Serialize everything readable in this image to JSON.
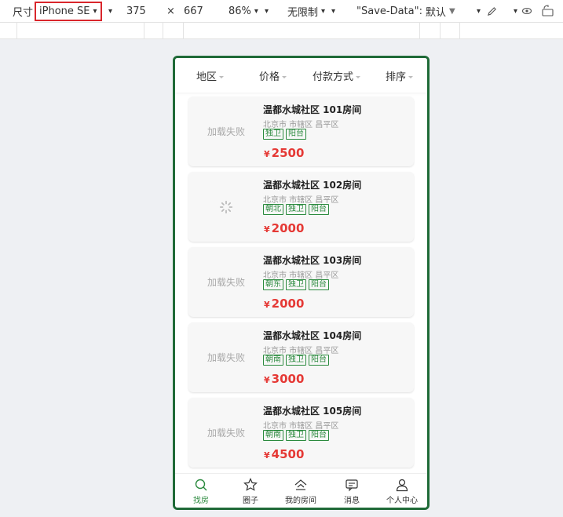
{
  "devtools": {
    "dims_label": "尺寸",
    "device": "iPhone SE",
    "width": "375",
    "times": "×",
    "height": "667",
    "zoom": "86%",
    "throttle": "无限制",
    "savedata_label": "\"Save-Data\":",
    "savedata_value": "默认"
  },
  "filters": [
    "地区",
    "价格",
    "付款方式",
    "排序"
  ],
  "cards": [
    {
      "title": "温都水城社区 101房间",
      "addr": "北京市 市辖区 昌平区",
      "tags": [
        "独卫",
        "阳台"
      ],
      "price": "2500",
      "image": "加载失败"
    },
    {
      "title": "温都水城社区 102房间",
      "addr": "北京市 市辖区 昌平区",
      "tags": [
        "朝北",
        "独卫",
        "阳台"
      ],
      "price": "2000",
      "image": ""
    },
    {
      "title": "温都水城社区 103房间",
      "addr": "北京市 市辖区 昌平区",
      "tags": [
        "朝东",
        "独卫",
        "阳台"
      ],
      "price": "2000",
      "image": "加载失败"
    },
    {
      "title": "温都水城社区 104房间",
      "addr": "北京市 市辖区 昌平区",
      "tags": [
        "朝南",
        "独卫",
        "阳台"
      ],
      "price": "3000",
      "image": "加载失败"
    },
    {
      "title": "温都水城社区 105房间",
      "addr": "北京市 市辖区 昌平区",
      "tags": [
        "朝南",
        "独卫",
        "阳台"
      ],
      "price": "4500",
      "image": "加载失败"
    }
  ],
  "currency": "¥",
  "tabs": [
    {
      "label": "找房",
      "icon": "search-icon"
    },
    {
      "label": "圈子",
      "icon": "star-icon"
    },
    {
      "label": "我的房间",
      "icon": "home-icon"
    },
    {
      "label": "消息",
      "icon": "message-icon"
    },
    {
      "label": "个人中心",
      "icon": "user-icon"
    }
  ],
  "colors": {
    "accent": "#2b8a3e",
    "price": "#e53935",
    "frame": "#1f6a37",
    "highlight": "#d9262c"
  }
}
